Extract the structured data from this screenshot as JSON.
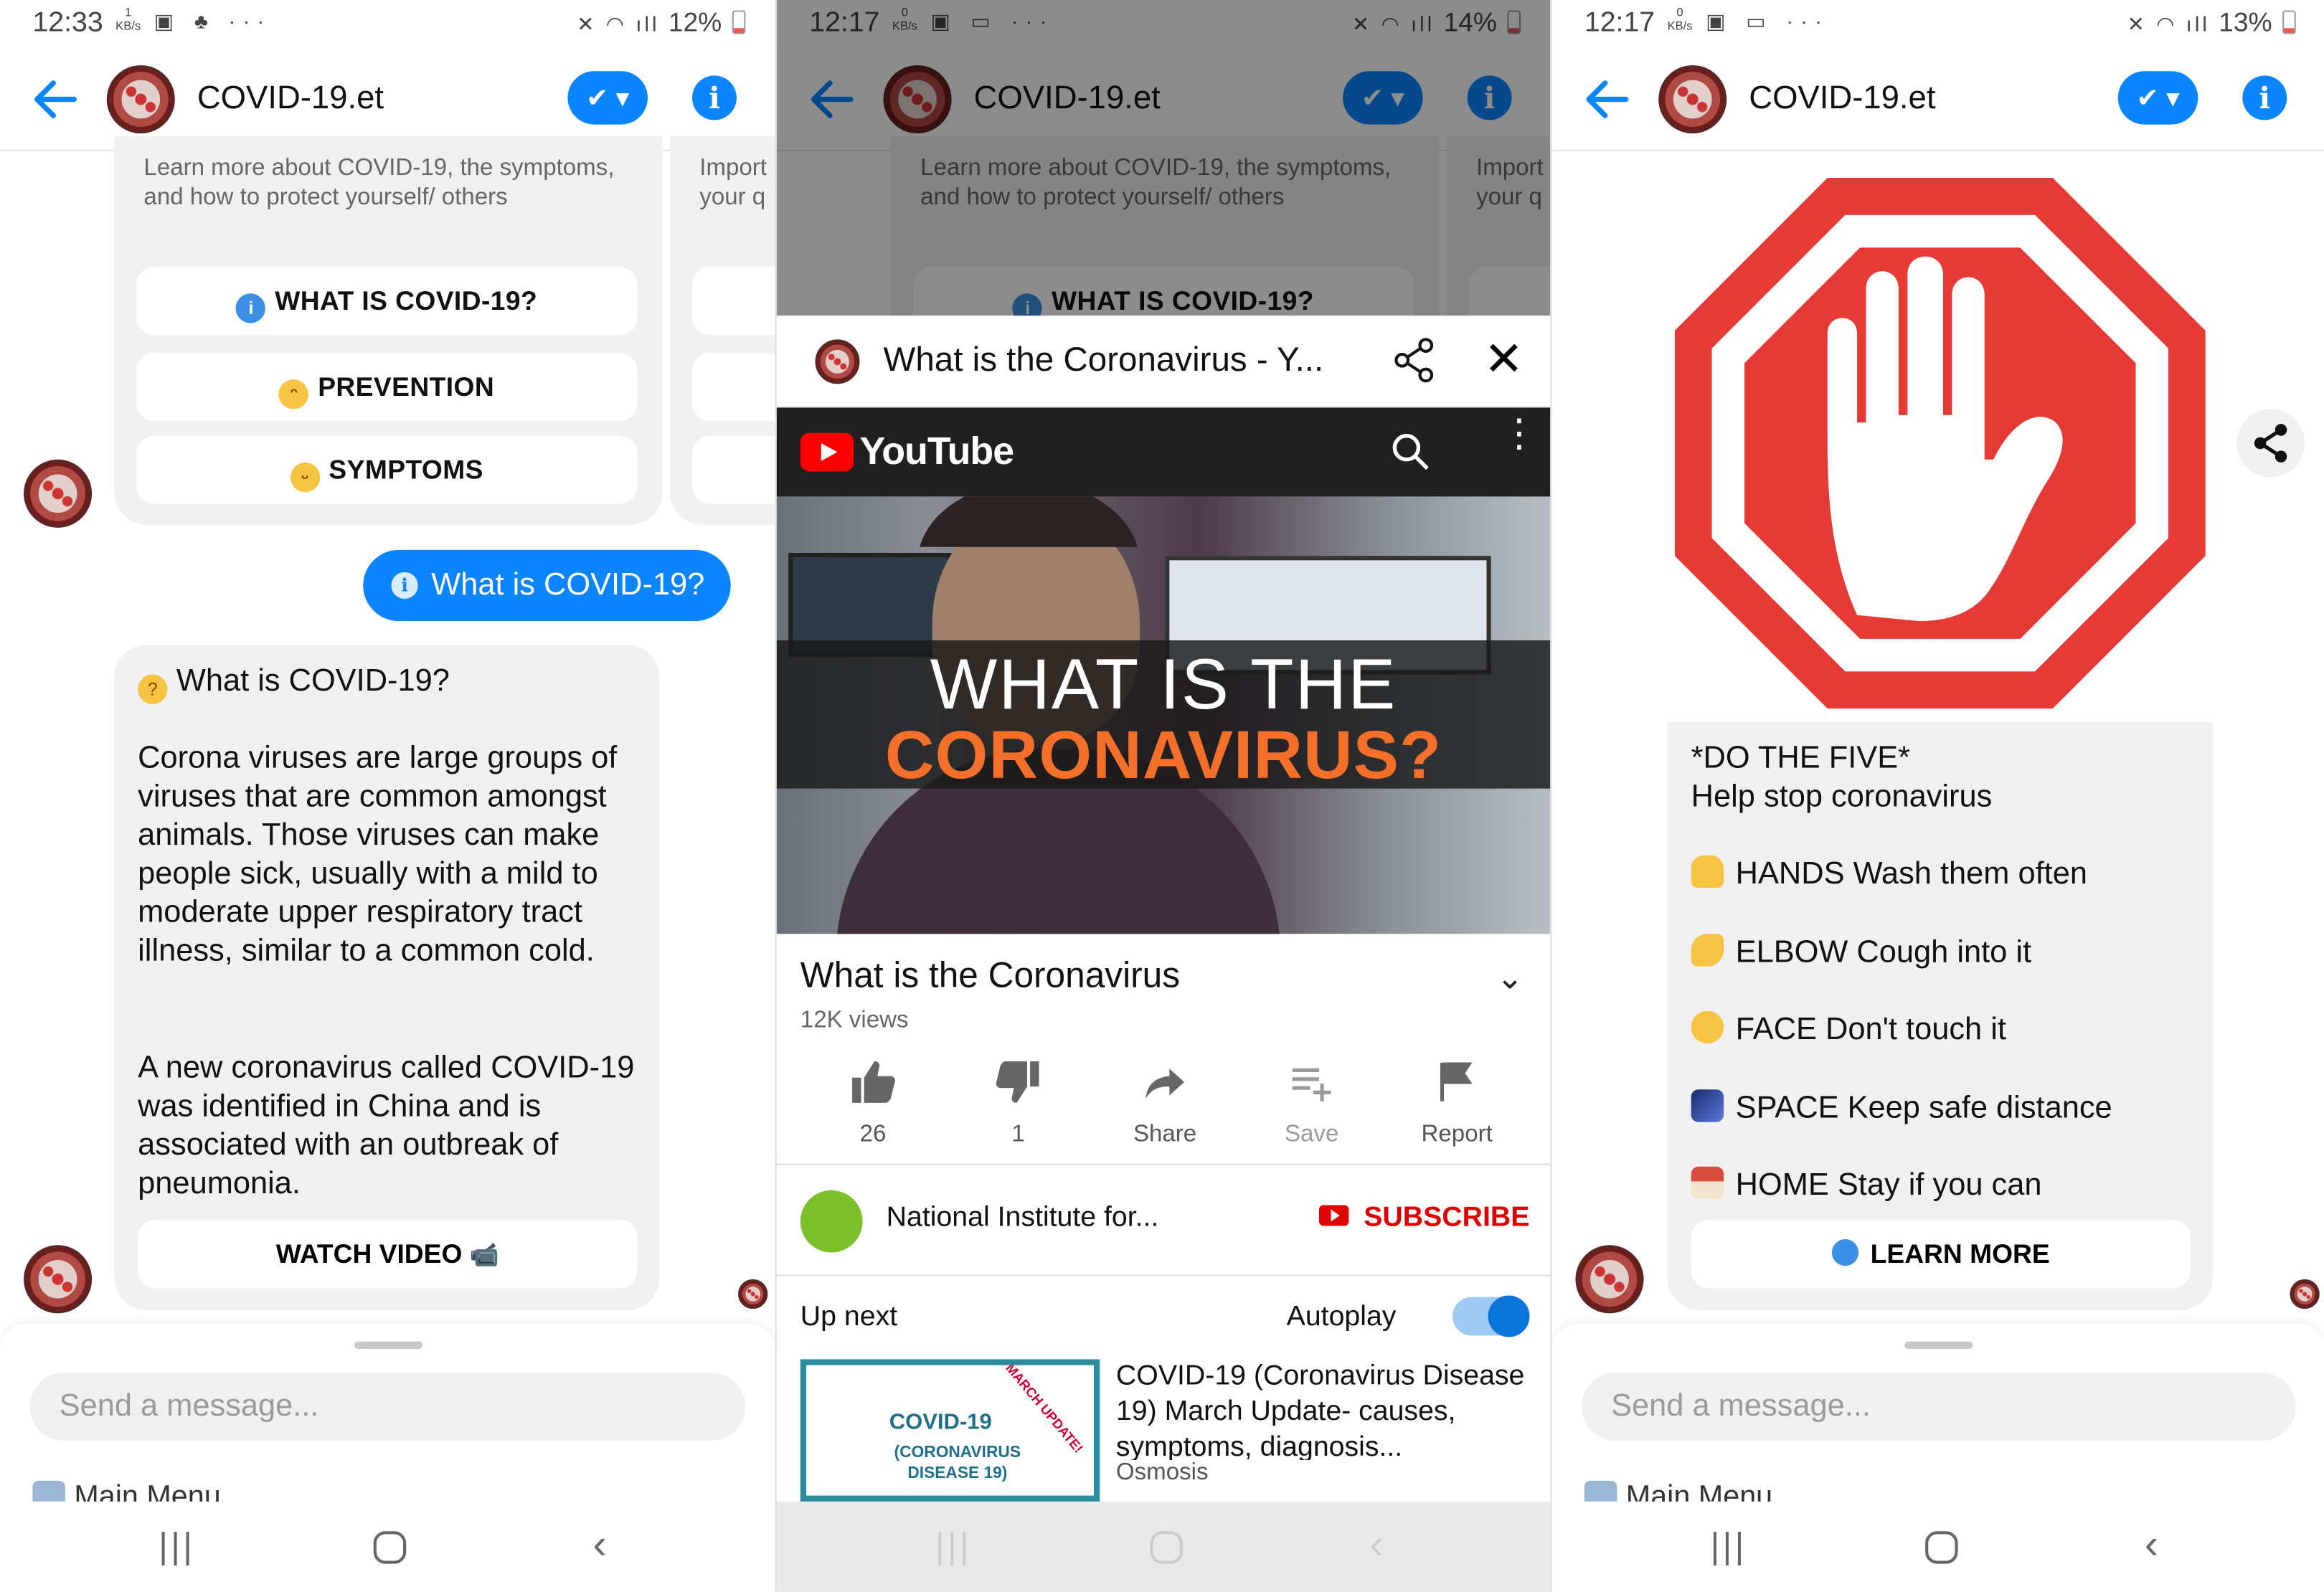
{
  "panels": {
    "p1": {
      "status": {
        "time": "12:33",
        "kbs": "1\nKB/s",
        "battery": "12%"
      },
      "header": {
        "title": "COVID-19.et"
      },
      "card_text": "Learn more about COVID-19, the symptoms, and how to protect yourself/ others",
      "card_peek_text": "Import your q",
      "quick_replies": [
        "WHAT IS COVID-19?",
        "PREVENTION",
        "SYMPTOMS"
      ],
      "user_message": "What is COVID-19?",
      "bot_message": {
        "heading": "What is COVID-19?",
        "para1": "Corona viruses are large groups of viruses that are common amongst animals. Those viruses can make people sick, usually with a mild to moderate upper respiratory tract illness, similar to a common cold.",
        "para2": "A new coronavirus called COVID-19 was identified in China and is associated with an outbreak of pneumonia.",
        "button": "WATCH VIDEO"
      },
      "composer_placeholder": "Send a message...",
      "main_menu": "Main Menu"
    },
    "p2": {
      "status": {
        "time": "12:17",
        "kbs": "0\nKB/s",
        "battery": "14%"
      },
      "header": {
        "title": "COVID-19.et"
      },
      "card_text": "Learn more about COVID-19, the symptoms, and how to protect yourself/ others",
      "card_peek_text": "Import your q",
      "peek_button": "WHAT IS COVID-19?",
      "webview_title": "What is the Coronavirus - Y...",
      "youtube_word": "YouTube",
      "video_overlay_line1": "WHAT IS THE",
      "video_overlay_line2": "CORONAVIRUS?",
      "video_title": "What is the Coronavirus",
      "views": "12K views",
      "actions": [
        {
          "label": "26",
          "icon": "thumbs-up-icon"
        },
        {
          "label": "1",
          "icon": "thumbs-down-icon"
        },
        {
          "label": "Share",
          "icon": "share-arrow-icon"
        },
        {
          "label": "Save",
          "icon": "playlist-add-icon"
        },
        {
          "label": "Report",
          "icon": "flag-icon"
        }
      ],
      "channel_name": "National Institute for...",
      "subscribe": "SUBSCRIBE",
      "up_next": "Up next",
      "autoplay": "Autoplay",
      "next_video": {
        "thumb_line1": "COVID-19",
        "thumb_line2": "(CORONAVIRUS DISEASE 19)",
        "thumb_tag": "MARCH UPDATE!",
        "title": "COVID-19 (Coronavirus Disease 19) March Update- causes, symptoms, diagnosis...",
        "channel": "Osmosis"
      }
    },
    "p3": {
      "status": {
        "time": "12:17",
        "kbs": "0\nKB/s",
        "battery": "13%"
      },
      "header": {
        "title": "COVID-19.et"
      },
      "do_five": {
        "title": "*DO THE FIVE*",
        "subtitle": "Help stop coronavirus",
        "items": [
          "HANDS Wash them often",
          "ELBOW Cough into it",
          "FACE Don't touch it",
          "SPACE Keep safe distance",
          "HOME Stay if you can"
        ],
        "button": "LEARN MORE"
      },
      "composer_placeholder": "Send a message...",
      "main_menu": "Main Menu"
    }
  },
  "colors": {
    "accent": "#0a84ff",
    "stop_red": "#e53935",
    "youtube_red": "#ff0000",
    "bubble_gray": "#f0f0f0"
  }
}
